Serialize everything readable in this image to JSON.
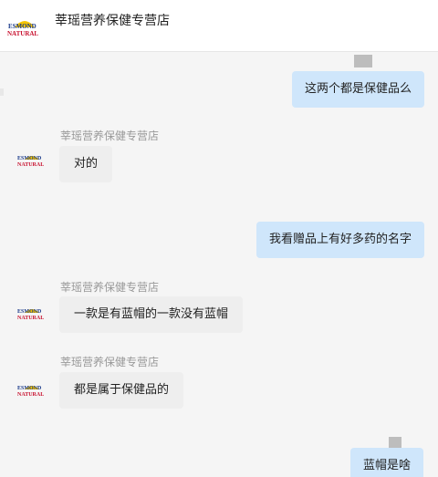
{
  "header": {
    "store_name": "莘瑶营养保健专营店"
  },
  "messages": [
    {
      "text": "这两个都是保健品么"
    },
    {
      "sender": "莘瑶营养保健专营店",
      "text": "对的"
    },
    {
      "text": "我看赠品上有好多药的名字"
    },
    {
      "sender": "莘瑶营养保健专营店",
      "text": "一款是有蓝帽的一款没有蓝帽"
    },
    {
      "sender": "莘瑶营养保健专营店",
      "text": "都是属于保健品的"
    },
    {
      "text": "蓝帽是啥"
    }
  ],
  "colors": {
    "outgoing_bubble": "#cfe6fb",
    "incoming_bubble": "#eeeeee",
    "background": "#f5f5f5"
  },
  "icons": {
    "store_logo": "esmond-natural-logo-icon"
  }
}
